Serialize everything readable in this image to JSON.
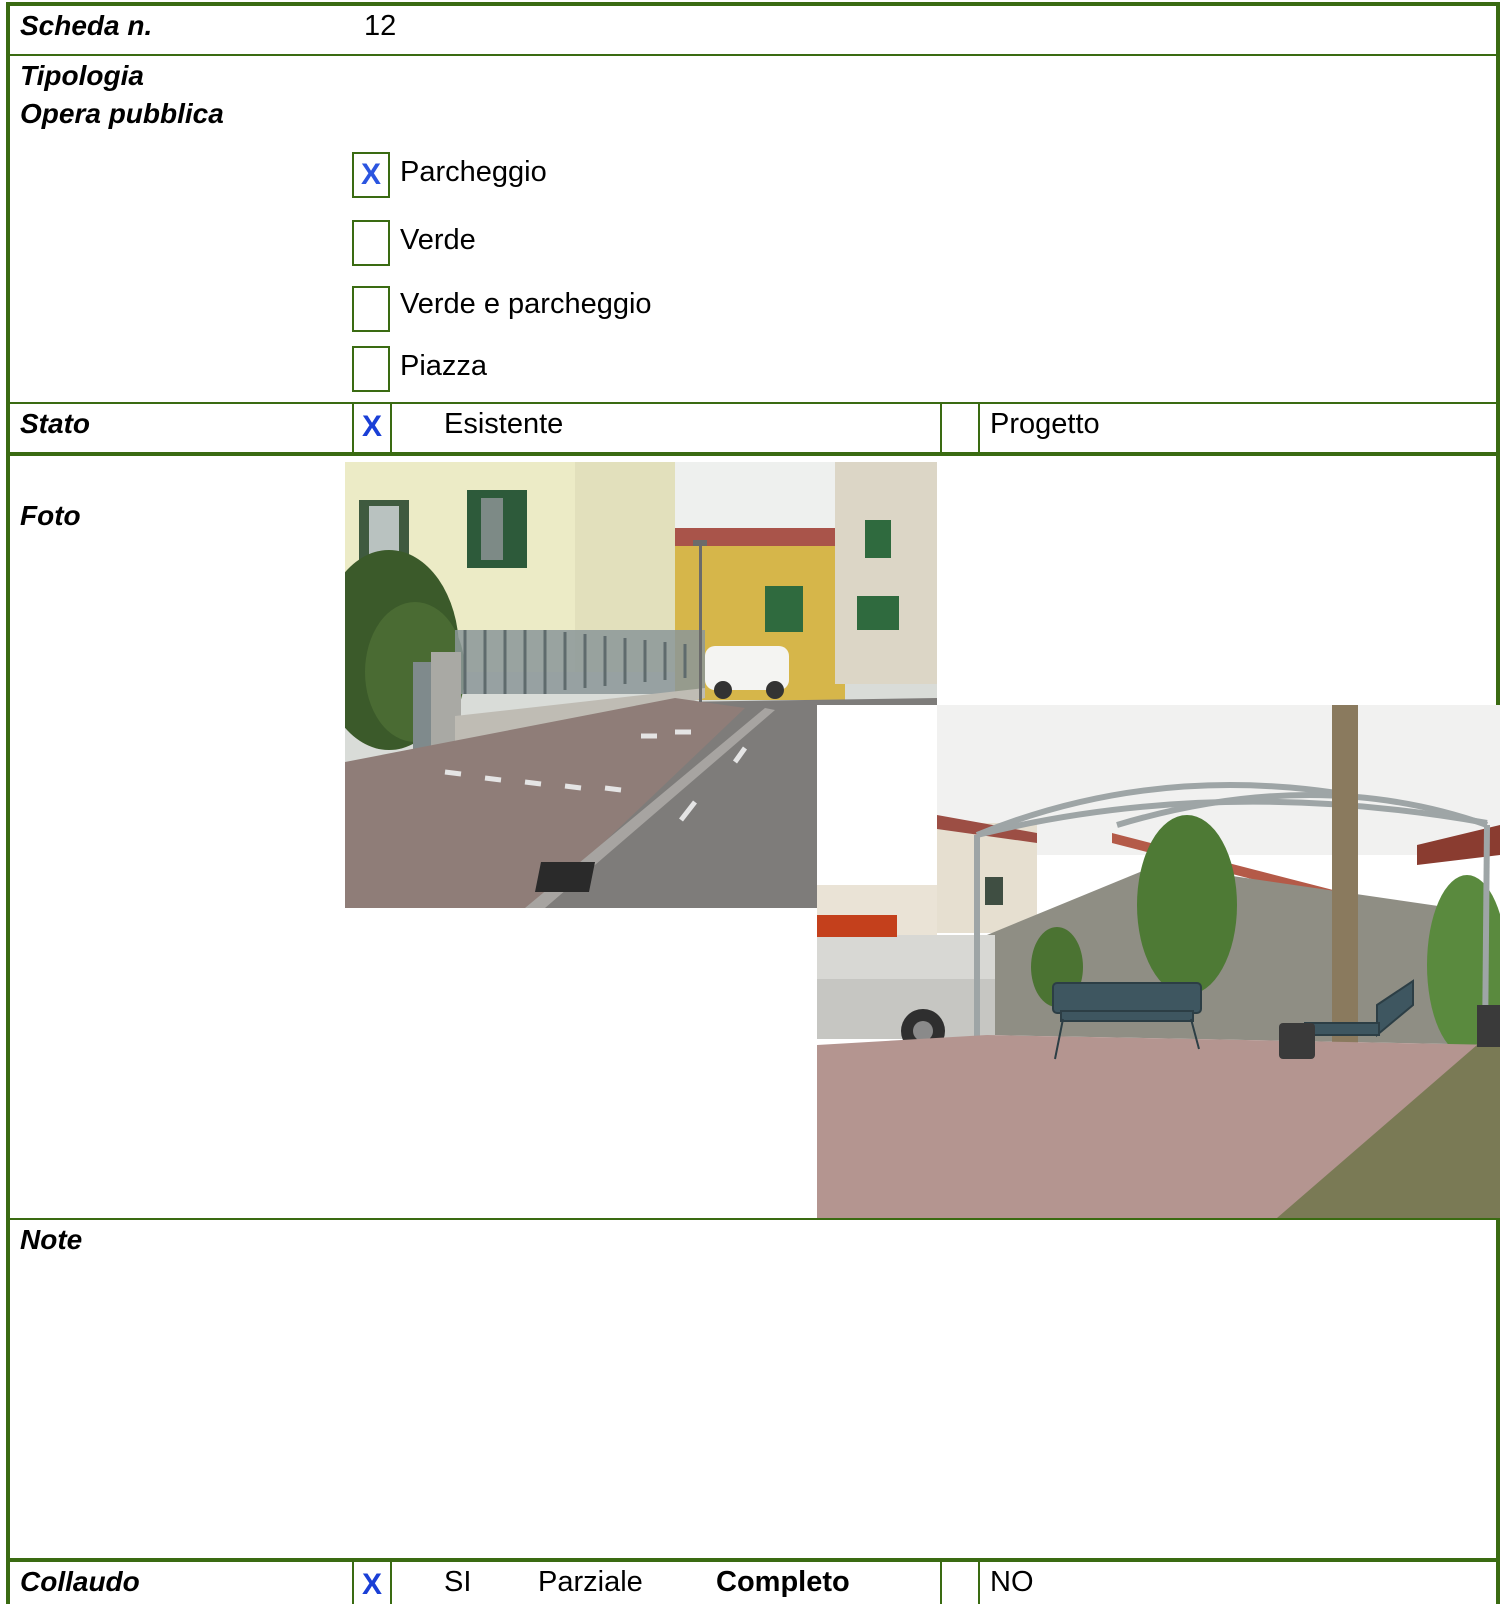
{
  "scheda": {
    "label": "Scheda n.",
    "value": "12"
  },
  "tipologia": {
    "label_line1": "Tipologia",
    "label_line2": "Opera pubblica",
    "options": [
      {
        "label": "Parcheggio",
        "checked": "X"
      },
      {
        "label": "Verde",
        "checked": ""
      },
      {
        "label": "Verde e parcheggio",
        "checked": ""
      },
      {
        "label": "Piazza",
        "checked": ""
      }
    ]
  },
  "stato": {
    "label": "Stato",
    "mark": "X",
    "existing": "Esistente",
    "project": "Progetto"
  },
  "foto": {
    "label": "Foto"
  },
  "note": {
    "label": "Note"
  },
  "collaudo": {
    "label": "Collaudo",
    "mark": "X",
    "si": "SI",
    "parziale": "Parziale",
    "completo": "Completo",
    "no": "NO"
  },
  "colors": {
    "border": "#3a6b12",
    "check": "#2b55e0"
  }
}
